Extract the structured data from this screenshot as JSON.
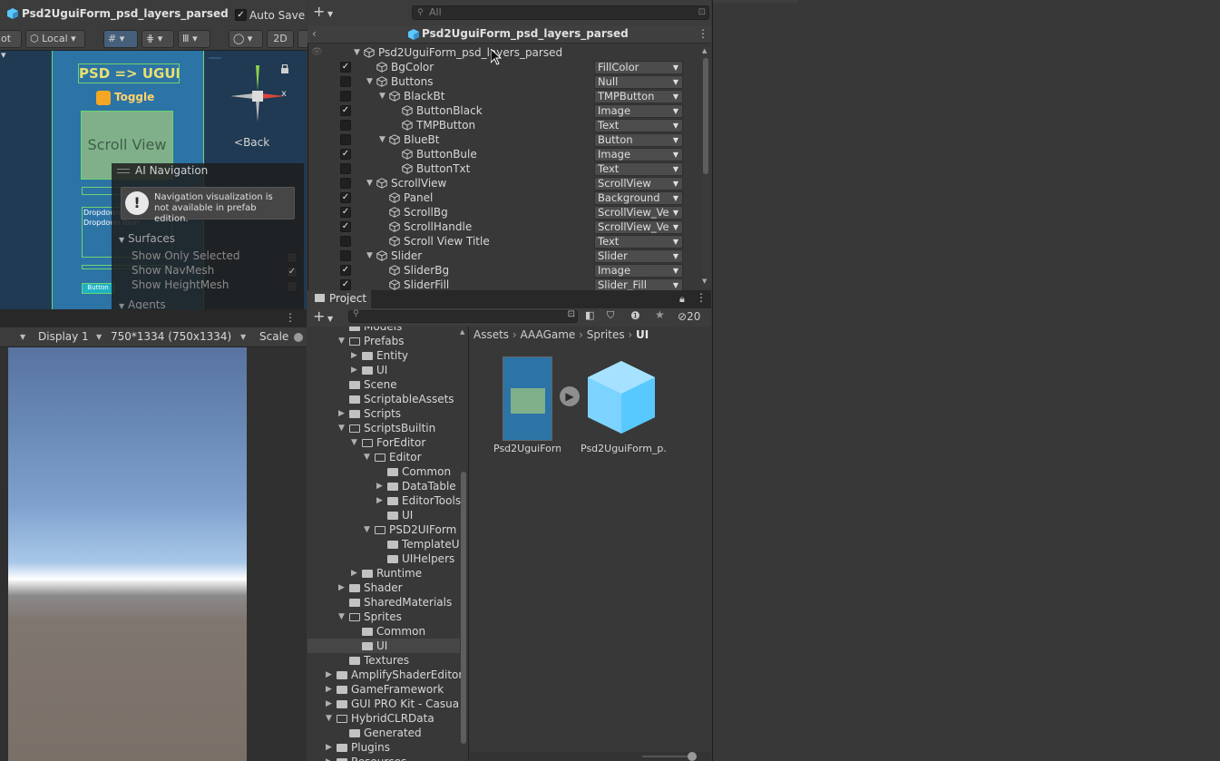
{
  "scene": {
    "prefab_title": "Psd2UguiForm_psd_layers_parsed",
    "auto_save_label": "Auto Save",
    "auto_save_checked": true,
    "toolbar": {
      "pivot_label": "ot",
      "local_label": "Local",
      "mode_2d": "2D"
    },
    "canvas_mock": {
      "title": "PSD => UGUI",
      "toggle": "Toggle",
      "scroll_view": "Scroll View",
      "dropdown": "Dropdown",
      "dropdown_item": "Dropdown Item",
      "button": "Button"
    },
    "gizmo": {
      "x_label": "x",
      "back_label": "Back"
    },
    "ai_nav": {
      "title": "AI Navigation",
      "warning": "Navigation visualization is not available in prefab edition.",
      "surfaces": "Surfaces",
      "options": [
        {
          "label": "Show Only Selected",
          "checked": false
        },
        {
          "label": "Show NavMesh",
          "checked": true
        },
        {
          "label": "Show HeightMesh",
          "checked": false
        }
      ],
      "agents": "Agents"
    }
  },
  "game": {
    "display": "Display 1",
    "resolution": "750*1334 (750x1334)",
    "scale_label": "Scale"
  },
  "hierarchy": {
    "search_placeholder": "All",
    "breadcrumb": "Psd2UguiForm_psd_layers_parsed",
    "rows": [
      {
        "name": "Psd2UguiForm_psd_layers_parsed",
        "depth": 0,
        "expand": "open",
        "check": null,
        "dd": null
      },
      {
        "name": "BgColor",
        "depth": 1,
        "expand": null,
        "check": true,
        "dd": "FillColor"
      },
      {
        "name": "Buttons",
        "depth": 1,
        "expand": "open",
        "check": false,
        "dd": "Null"
      },
      {
        "name": "BlackBt",
        "depth": 2,
        "expand": "open",
        "check": false,
        "dd": "TMPButton"
      },
      {
        "name": "ButtonBlack",
        "depth": 3,
        "expand": null,
        "check": true,
        "dd": "Image"
      },
      {
        "name": "TMPButton",
        "depth": 3,
        "expand": null,
        "check": false,
        "dd": "Text"
      },
      {
        "name": "BlueBt",
        "depth": 2,
        "expand": "open",
        "check": false,
        "dd": "Button"
      },
      {
        "name": "ButtonBule",
        "depth": 3,
        "expand": null,
        "check": true,
        "dd": "Image"
      },
      {
        "name": "ButtonTxt",
        "depth": 3,
        "expand": null,
        "check": false,
        "dd": "Text"
      },
      {
        "name": "ScrollView",
        "depth": 1,
        "expand": "open",
        "check": false,
        "dd": "ScrollView"
      },
      {
        "name": "Panel",
        "depth": 2,
        "expand": null,
        "check": true,
        "dd": "Background"
      },
      {
        "name": "ScrollBg",
        "depth": 2,
        "expand": null,
        "check": true,
        "dd": "ScrollView_Ve"
      },
      {
        "name": "ScrollHandle",
        "depth": 2,
        "expand": null,
        "check": true,
        "dd": "ScrollView_Ve"
      },
      {
        "name": "Scroll View Title",
        "depth": 2,
        "expand": null,
        "check": false,
        "dd": "Text"
      },
      {
        "name": "Slider",
        "depth": 1,
        "expand": "open",
        "check": false,
        "dd": "Slider"
      },
      {
        "name": "SliderBg",
        "depth": 2,
        "expand": null,
        "check": true,
        "dd": "Image"
      },
      {
        "name": "SliderFill",
        "depth": 2,
        "expand": null,
        "check": true,
        "dd": "Slider_Fill"
      }
    ]
  },
  "project": {
    "tab_label": "Project",
    "hidden_count": "20",
    "breadcrumb": [
      "Assets",
      "AAAGame",
      "Sprites",
      "UI"
    ],
    "tree": [
      {
        "name": "Models",
        "depth": 2,
        "expand": null
      },
      {
        "name": "Prefabs",
        "depth": 2,
        "expand": "open"
      },
      {
        "name": "Entity",
        "depth": 3,
        "expand": "closed"
      },
      {
        "name": "UI",
        "depth": 3,
        "expand": "closed"
      },
      {
        "name": "Scene",
        "depth": 2,
        "expand": null
      },
      {
        "name": "ScriptableAssets",
        "depth": 2,
        "expand": null
      },
      {
        "name": "Scripts",
        "depth": 2,
        "expand": "closed"
      },
      {
        "name": "ScriptsBuiltin",
        "depth": 2,
        "expand": "open"
      },
      {
        "name": "ForEditor",
        "depth": 3,
        "expand": "open"
      },
      {
        "name": "Editor",
        "depth": 4,
        "expand": "open"
      },
      {
        "name": "Common",
        "depth": 5,
        "expand": null
      },
      {
        "name": "DataTable",
        "depth": 5,
        "expand": "closed"
      },
      {
        "name": "EditorTools",
        "depth": 5,
        "expand": "closed"
      },
      {
        "name": "UI",
        "depth": 5,
        "expand": null
      },
      {
        "name": "PSD2UIForm",
        "depth": 4,
        "expand": "open"
      },
      {
        "name": "TemplateU",
        "depth": 5,
        "expand": null
      },
      {
        "name": "UIHelpers",
        "depth": 5,
        "expand": null
      },
      {
        "name": "Runtime",
        "depth": 3,
        "expand": "closed"
      },
      {
        "name": "Shader",
        "depth": 2,
        "expand": "closed"
      },
      {
        "name": "SharedMaterials",
        "depth": 2,
        "expand": null
      },
      {
        "name": "Sprites",
        "depth": 2,
        "expand": "open"
      },
      {
        "name": "Common",
        "depth": 3,
        "expand": null
      },
      {
        "name": "UI",
        "depth": 3,
        "expand": null,
        "selected": true
      },
      {
        "name": "Textures",
        "depth": 2,
        "expand": null
      },
      {
        "name": "AmplifyShaderEditor",
        "depth": 1,
        "expand": "closed"
      },
      {
        "name": "GameFramework",
        "depth": 1,
        "expand": "closed"
      },
      {
        "name": "GUI PRO Kit - Casua",
        "depth": 1,
        "expand": "closed"
      },
      {
        "name": "HybridCLRData",
        "depth": 1,
        "expand": "open"
      },
      {
        "name": "Generated",
        "depth": 2,
        "expand": null
      },
      {
        "name": "Plugins",
        "depth": 1,
        "expand": "closed"
      },
      {
        "name": "Resources",
        "depth": 1,
        "expand": "closed"
      }
    ],
    "assets": [
      {
        "name": "Psd2UguiForm",
        "kind": "sprite"
      },
      {
        "name": "Psd2UguiForm_p...",
        "kind": "prefab"
      }
    ]
  },
  "colors": {
    "accent_blue": "#58c9ff",
    "selection": "#2c5d87",
    "bg": "#383838"
  }
}
